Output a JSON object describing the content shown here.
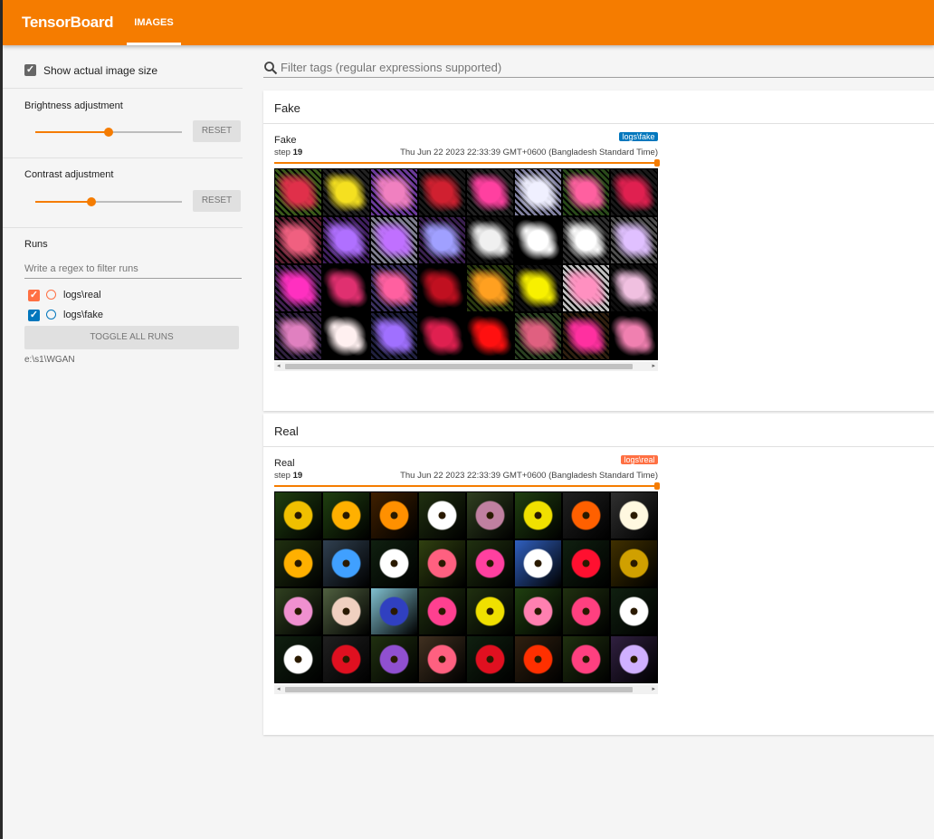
{
  "header": {
    "brand": "TensorBoard",
    "tabs": [
      {
        "label": "IMAGES",
        "active": true
      }
    ],
    "accent_color": "#f57c00"
  },
  "sidebar": {
    "show_actual_size_label": "Show actual image size",
    "show_actual_size_checked": true,
    "brightness": {
      "label": "Brightness adjustment",
      "value": 0.5,
      "reset_label": "RESET"
    },
    "contrast": {
      "label": "Contrast adjustment",
      "value": 0.38,
      "reset_label": "RESET"
    },
    "runs": {
      "title": "Runs",
      "filter_placeholder": "Write a regex to filter runs",
      "items": [
        {
          "name": "logs\\real",
          "checked": true,
          "color": "#ff7043"
        },
        {
          "name": "logs\\fake",
          "checked": true,
          "color": "#0277bd"
        }
      ],
      "toggle_all_label": "TOGGLE ALL RUNS",
      "logdir": "e:\\s1\\WGAN"
    }
  },
  "main": {
    "search_placeholder": "Filter tags (regular expressions supported)",
    "sections": [
      {
        "title": "Fake",
        "card": {
          "name": "Fake",
          "step_prefix": "step",
          "step": "19",
          "time": "Thu Jun 22 2023 22:33:39 GMT+0600 (Bangladesh Standard Time)",
          "run_tag": "logs\\fake",
          "run_tag_color": "#0277bd"
        }
      },
      {
        "title": "Real",
        "card": {
          "name": "Real",
          "step_prefix": "step",
          "step": "19",
          "time": "Thu Jun 22 2023 22:33:39 GMT+0600 (Bangladesh Standard Time)",
          "run_tag": "logs\\real",
          "run_tag_color": "#ff7043"
        }
      }
    ]
  }
}
